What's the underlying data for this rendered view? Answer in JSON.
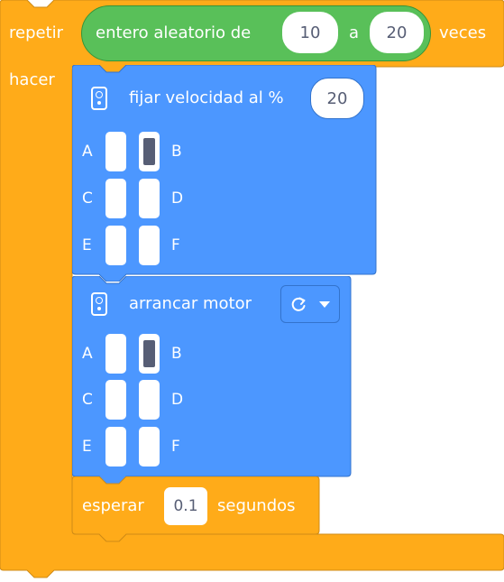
{
  "colors": {
    "control": "#ffab19",
    "operator": "#59c059",
    "motor": "#4c97ff",
    "input_text": "#575e75"
  },
  "repeat": {
    "label_repeat": "repetir",
    "label_times": "veces",
    "label_do": "hacer",
    "random": {
      "label": "entero aleatorio de",
      "from": "10",
      "between": "a",
      "to": "20"
    }
  },
  "set_speed": {
    "icon": "hub-icon",
    "label": "fijar velocidad al %",
    "value": "20",
    "ports": [
      "A",
      "B",
      "C",
      "D",
      "E",
      "F"
    ],
    "selected_ports": [
      "B"
    ]
  },
  "start_motor": {
    "icon": "hub-icon",
    "label": "arrancar motor",
    "direction_icon": "clockwise-icon",
    "dropdown_icon": "caret-down-icon",
    "ports": [
      "A",
      "B",
      "C",
      "D",
      "E",
      "F"
    ],
    "selected_ports": [
      "B"
    ]
  },
  "wait": {
    "label": "esperar",
    "value": "0.1",
    "unit": "segundos"
  }
}
